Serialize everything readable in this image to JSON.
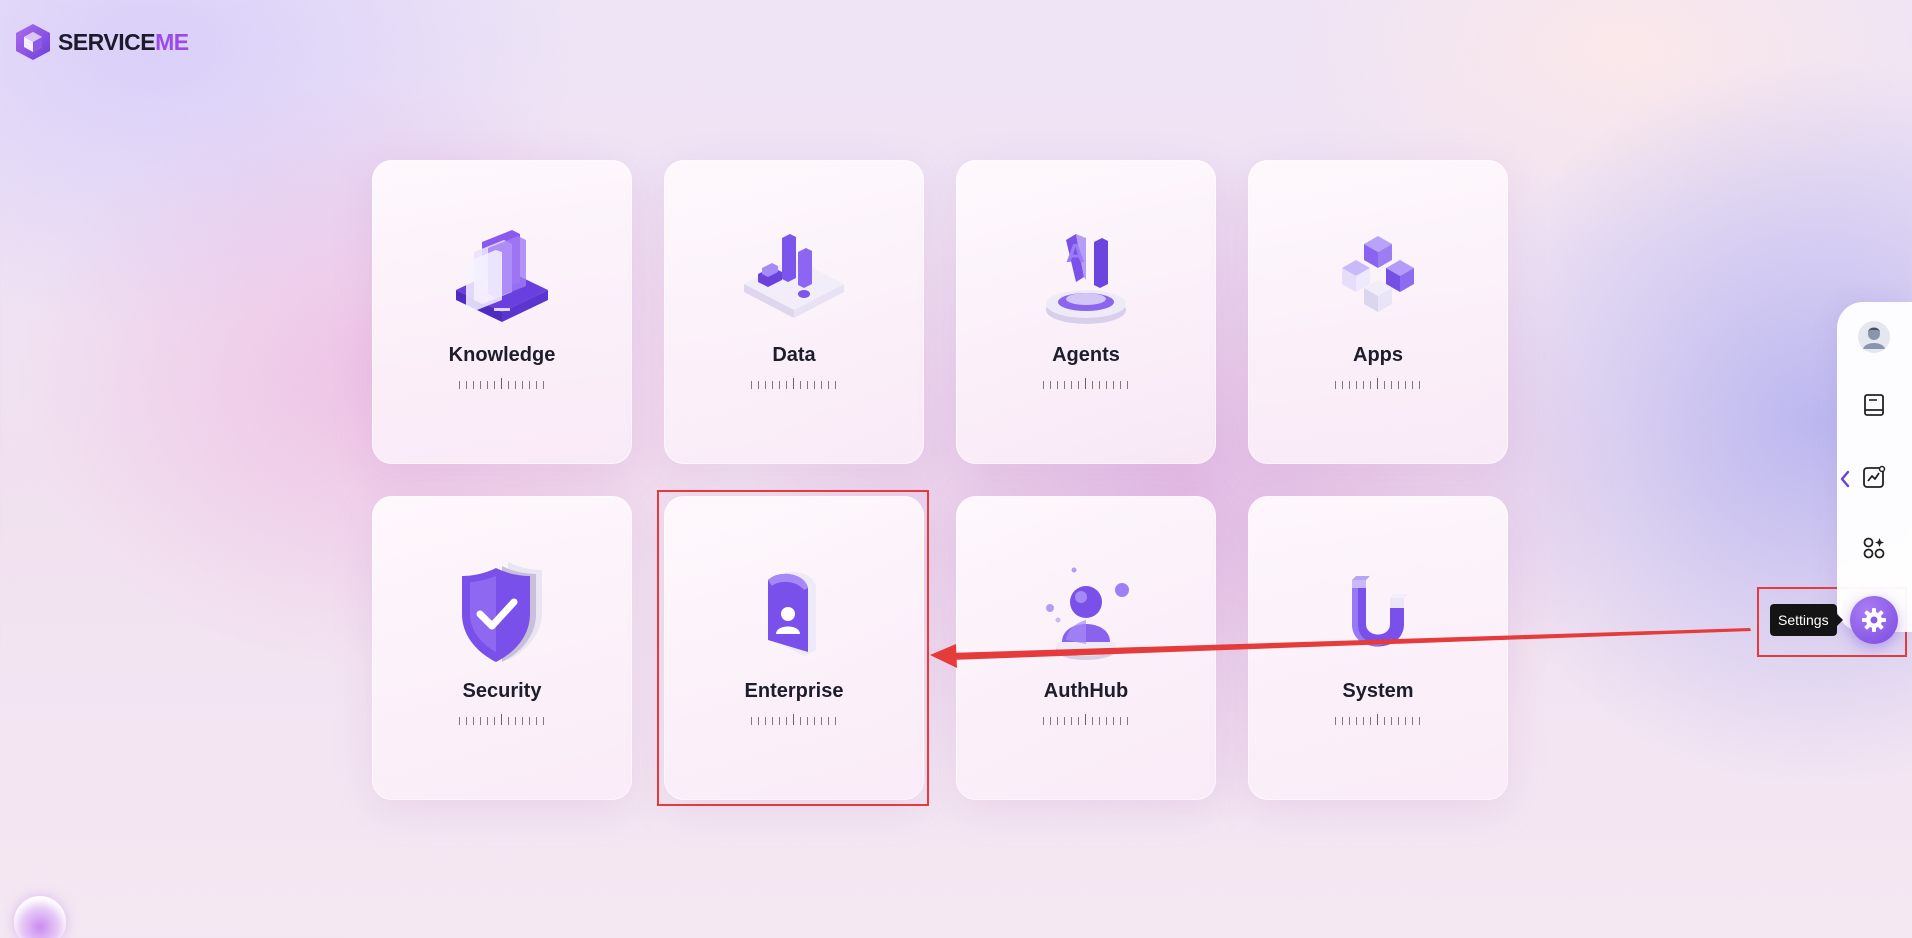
{
  "brand": {
    "name_main": "SERVICE",
    "name_accent": "ME",
    "accent_color": "#9a4be6"
  },
  "cards": [
    {
      "title": "Knowledge",
      "icon": "knowledge-books-icon"
    },
    {
      "title": "Data",
      "icon": "data-chart-icon"
    },
    {
      "title": "Agents",
      "icon": "agents-ai-icon"
    },
    {
      "title": "Apps",
      "icon": "apps-cubes-icon"
    },
    {
      "title": "Security",
      "icon": "security-shield-icon"
    },
    {
      "title": "Enterprise",
      "icon": "enterprise-badge-icon"
    },
    {
      "title": "AuthHub",
      "icon": "authhub-user-icon"
    },
    {
      "title": "System",
      "icon": "system-magnet-icon"
    }
  ],
  "sidebar": {
    "items": [
      {
        "icon": "user-avatar-icon"
      },
      {
        "icon": "book-icon"
      },
      {
        "icon": "analytics-icon"
      },
      {
        "icon": "apps-grid-icon"
      }
    ],
    "collapse_icon": "chevron-left-icon",
    "settings": {
      "icon": "gear-icon",
      "tooltip": "Settings"
    }
  },
  "colors": {
    "annotation": "#e53b3b",
    "primary_purple": "#7a4ce0"
  }
}
